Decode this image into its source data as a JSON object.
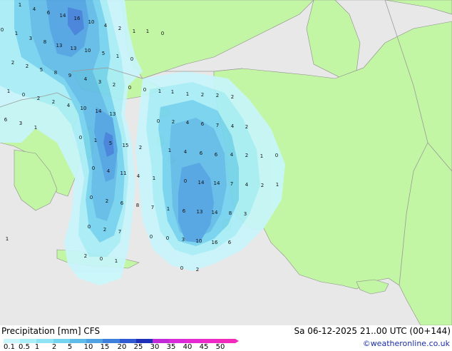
{
  "footer": {
    "title": "Precipitation [mm] CFS",
    "datetime": "Sa 06-12-2025 21..00 UTC (00+144)",
    "credit": "©weatheronline.co.uk"
  },
  "legend": {
    "ticks": [
      "0.1",
      "0.5",
      "1",
      "2",
      "5",
      "10",
      "15",
      "20",
      "25",
      "30",
      "35",
      "40",
      "45",
      "50"
    ],
    "colors": [
      "#c8f6fb",
      "#a9eef8",
      "#8fe3f5",
      "#74d3ef",
      "#5fbce8",
      "#4fa3e3",
      "#3f7fdc",
      "#2f59d1",
      "#1f2fb8",
      "#c02ad8",
      "#d82ad8",
      "#e52ad2",
      "#ee2ac6",
      "#f22abb"
    ]
  },
  "map_colors": {
    "sea": "#e8e8e8",
    "land": "#c2f5a4",
    "border": "#9a9a9a",
    "coast": "#8c8c8c"
  },
  "values": [
    {
      "t": "1"
    },
    {
      "t": "4"
    },
    {
      "t": "6"
    },
    {
      "t": "14"
    },
    {
      "t": "16"
    },
    {
      "t": "10"
    },
    {
      "t": "4"
    },
    {
      "t": "2"
    },
    {
      "t": "1"
    },
    {
      "t": "1"
    },
    {
      "t": "0"
    },
    {
      "t": "0"
    },
    {
      "t": "1"
    },
    {
      "t": "3"
    },
    {
      "t": "8"
    },
    {
      "t": "13"
    },
    {
      "t": "13"
    },
    {
      "t": "10"
    },
    {
      "t": "5"
    },
    {
      "t": "1"
    },
    {
      "t": "0"
    },
    {
      "t": "2"
    },
    {
      "t": "2"
    },
    {
      "t": "5"
    },
    {
      "t": "8"
    },
    {
      "t": "9"
    },
    {
      "t": "4"
    },
    {
      "t": "3"
    },
    {
      "t": "2"
    },
    {
      "t": "0"
    },
    {
      "t": "0"
    },
    {
      "t": "1"
    },
    {
      "t": "1"
    },
    {
      "t": "0"
    },
    {
      "t": "2"
    },
    {
      "t": "2"
    },
    {
      "t": "4"
    },
    {
      "t": "10"
    },
    {
      "t": "14"
    },
    {
      "t": "13"
    },
    {
      "t": "1"
    },
    {
      "t": "1"
    },
    {
      "t": "2"
    },
    {
      "t": "2"
    },
    {
      "t": "2"
    },
    {
      "t": "6"
    },
    {
      "t": "3"
    },
    {
      "t": "1"
    },
    {
      "t": "0"
    },
    {
      "t": "1"
    },
    {
      "t": "5"
    },
    {
      "t": "15"
    },
    {
      "t": "2"
    },
    {
      "t": "0"
    },
    {
      "t": "2"
    },
    {
      "t": "4"
    },
    {
      "t": "6"
    },
    {
      "t": "7"
    },
    {
      "t": "4"
    },
    {
      "t": "2"
    },
    {
      "t": "0"
    },
    {
      "t": "4"
    },
    {
      "t": "11"
    },
    {
      "t": "4"
    },
    {
      "t": "1"
    },
    {
      "t": "1"
    },
    {
      "t": "4"
    },
    {
      "t": "6"
    },
    {
      "t": "6"
    },
    {
      "t": "4"
    },
    {
      "t": "2"
    },
    {
      "t": "1"
    },
    {
      "t": "0"
    },
    {
      "t": "0"
    },
    {
      "t": "2"
    },
    {
      "t": "6"
    },
    {
      "t": "8"
    },
    {
      "t": "0"
    },
    {
      "t": "14"
    },
    {
      "t": "14"
    },
    {
      "t": "7"
    },
    {
      "t": "4"
    },
    {
      "t": "2"
    },
    {
      "t": "1"
    },
    {
      "t": "0"
    },
    {
      "t": "2"
    },
    {
      "t": "7"
    },
    {
      "t": "7"
    },
    {
      "t": "1"
    },
    {
      "t": "6"
    },
    {
      "t": "13"
    },
    {
      "t": "14"
    },
    {
      "t": "8"
    },
    {
      "t": "3"
    },
    {
      "t": "1"
    },
    {
      "t": "0"
    },
    {
      "t": "0"
    },
    {
      "t": "3"
    },
    {
      "t": "10"
    },
    {
      "t": "16"
    },
    {
      "t": "6"
    },
    {
      "t": "2"
    },
    {
      "t": "0"
    },
    {
      "t": "1"
    },
    {
      "t": "0"
    },
    {
      "t": "2"
    },
    {
      "t": "0"
    }
  ]
}
